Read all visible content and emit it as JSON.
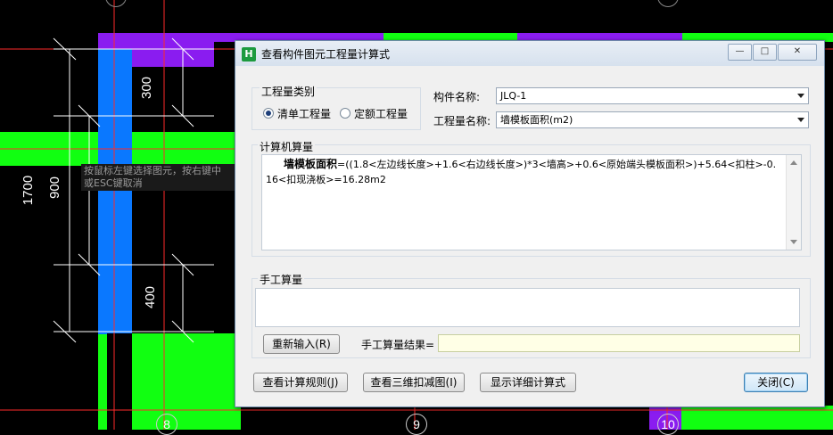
{
  "cad": {
    "dims": {
      "d300": "300",
      "d1700": "1700",
      "d900": "900",
      "d400": "400"
    },
    "tooltip": {
      "line1": "按鼠标左键选择图元，按右键中",
      "line2": "或ESC键取消"
    },
    "axis_labels": {
      "a8": "8",
      "a9": "9",
      "a10": "10"
    }
  },
  "dialog": {
    "app_icon": "app-logo-icon",
    "title": "查看构件图元工程量计算式",
    "window_buttons": {
      "minimize": "—",
      "restore": "□",
      "close": "✕"
    },
    "qty_type": {
      "label": "工程量类别",
      "options": [
        {
          "label": "清单工程量",
          "selected": true
        },
        {
          "label": "定额工程量",
          "selected": false
        }
      ]
    },
    "component_name": {
      "label": "构件名称:",
      "value": "JLQ-1"
    },
    "quantity_name": {
      "label": "工程量名称:",
      "value": "墙模板面积(m2)"
    },
    "computer_calc": {
      "label": "计算机算量",
      "formula_title": "墙模板面积",
      "formula_body": "=((1.8<左边线长度>+1.6<右边线长度>)*3<墙高>+0.6<原始端头模板面积>)+5.64<扣柱>-0.16<扣现浇板>=16.28m2"
    },
    "manual_calc": {
      "label": "手工算量",
      "reenter_button": "重新输入(R)",
      "result_label": "手工算量结果=",
      "result_value": ""
    },
    "footer": {
      "view_rules": "查看计算规则(J)",
      "view_3d": "查看三维扣减图(I)",
      "show_detail": "显示详细计算式",
      "close": "关闭(C)"
    }
  },
  "colors": {
    "purple": "#8a1cf0",
    "green": "#11ff11",
    "blue": "#0a78ff",
    "dialog_bg": "#f0f0f0",
    "manual_result_bg": "#ffffe6"
  }
}
